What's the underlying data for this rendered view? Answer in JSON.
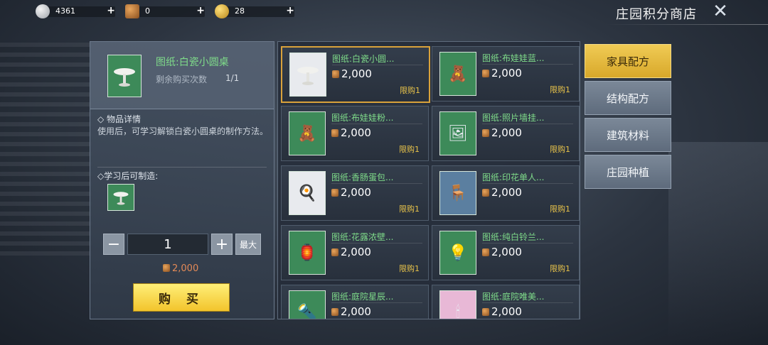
{
  "header": {
    "title": "庄园积分商店",
    "currencies": [
      {
        "name": "silver-coin",
        "value": "4361"
      },
      {
        "name": "bronze-badge",
        "value": "0"
      },
      {
        "name": "gold-coin",
        "value": "28"
      }
    ],
    "plus_label": "+"
  },
  "detail": {
    "item_name": "图纸:白瓷小圆桌",
    "remaining_label": "剩余购买次数",
    "remaining_count": "1/1",
    "details_title": "◇ 物品详情",
    "description": "使用后，可学习解锁白瓷小圆桌的制作方法。",
    "craftable_title": "◇学习后可制造:",
    "quantity": "1",
    "minus_label": "−",
    "plus_label": "+",
    "max_label": "最大",
    "total_price": "2,000",
    "buy_label": "购 买"
  },
  "items": [
    {
      "name": "图纸:白瓷小圆...",
      "price": "2,000",
      "limit": "限购1",
      "icon": "table"
    },
    {
      "name": "图纸:布娃娃蓝...",
      "price": "2,000",
      "limit": "限购1",
      "icon": "doll"
    },
    {
      "name": "图纸:布娃娃粉...",
      "price": "2,000",
      "limit": "限购1",
      "icon": "doll"
    },
    {
      "name": "图纸:照片墙挂...",
      "price": "2,000",
      "limit": "限购1",
      "icon": "photo-wall"
    },
    {
      "name": "图纸:香肠蛋包...",
      "price": "2,000",
      "limit": "限购1",
      "icon": "food-plate"
    },
    {
      "name": "图纸:印花单人...",
      "price": "2,000",
      "limit": "限购1",
      "icon": "armchair"
    },
    {
      "name": "图纸:花露浓壁...",
      "price": "2,000",
      "limit": "限购1",
      "icon": "wall-lamp"
    },
    {
      "name": "图纸:纯白铃兰...",
      "price": "2,000",
      "limit": "限购1",
      "icon": "chandelier"
    },
    {
      "name": "图纸:庭院星辰...",
      "price": "2,000",
      "limit": "",
      "icon": "garden-lamp"
    },
    {
      "name": "图纸:庭院唯美...",
      "price": "2,000",
      "limit": "",
      "icon": "garden-light"
    }
  ],
  "tabs": [
    {
      "label": "家具配方",
      "active": true
    },
    {
      "label": "结构配方",
      "active": false
    },
    {
      "label": "建筑材料",
      "active": false
    },
    {
      "label": "庄园种植",
      "active": false
    }
  ],
  "colors": {
    "item_name": "#7fdc8a",
    "limit": "#e7c24a",
    "price_total": "#e48a57",
    "active_tab": "#f0cb55",
    "selected_border": "#d9a23b"
  }
}
